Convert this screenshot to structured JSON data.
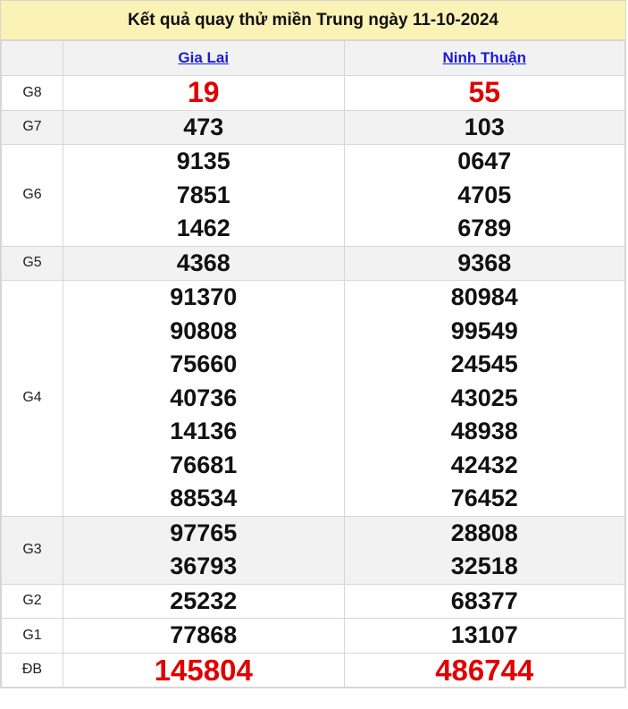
{
  "title": "Kết quả quay thử miền Trung ngày 11-10-2024",
  "provinces": [
    "Gia Lai",
    "Ninh Thuận"
  ],
  "rows": [
    {
      "label": "G8",
      "values": [
        [
          "19"
        ],
        [
          "55"
        ]
      ],
      "style": "red",
      "bg": "white"
    },
    {
      "label": "G7",
      "values": [
        [
          "473"
        ],
        [
          "103"
        ]
      ],
      "style": "normal",
      "bg": "gray"
    },
    {
      "label": "G6",
      "values": [
        [
          "9135",
          "7851",
          "1462"
        ],
        [
          "0647",
          "4705",
          "6789"
        ]
      ],
      "style": "normal",
      "bg": "white"
    },
    {
      "label": "G5",
      "values": [
        [
          "4368"
        ],
        [
          "9368"
        ]
      ],
      "style": "normal",
      "bg": "gray"
    },
    {
      "label": "G4",
      "values": [
        [
          "91370",
          "90808",
          "75660",
          "40736",
          "14136",
          "76681",
          "88534"
        ],
        [
          "80984",
          "99549",
          "24545",
          "43025",
          "48938",
          "42432",
          "76452"
        ]
      ],
      "style": "normal",
      "bg": "white"
    },
    {
      "label": "G3",
      "values": [
        [
          "97765",
          "36793"
        ],
        [
          "28808",
          "32518"
        ]
      ],
      "style": "normal",
      "bg": "gray"
    },
    {
      "label": "G2",
      "values": [
        [
          "25232"
        ],
        [
          "68377"
        ]
      ],
      "style": "normal",
      "bg": "white"
    },
    {
      "label": "G1",
      "values": [
        [
          "77868"
        ],
        [
          "13107"
        ]
      ],
      "style": "normal",
      "bg": "white"
    },
    {
      "label": "ĐB",
      "values": [
        [
          "145804"
        ],
        [
          "486744"
        ]
      ],
      "style": "red-db",
      "bg": "white"
    }
  ],
  "colors": {
    "title_bg": "#fbf2b5",
    "link": "#1a1ad4",
    "special": "#e00000"
  }
}
